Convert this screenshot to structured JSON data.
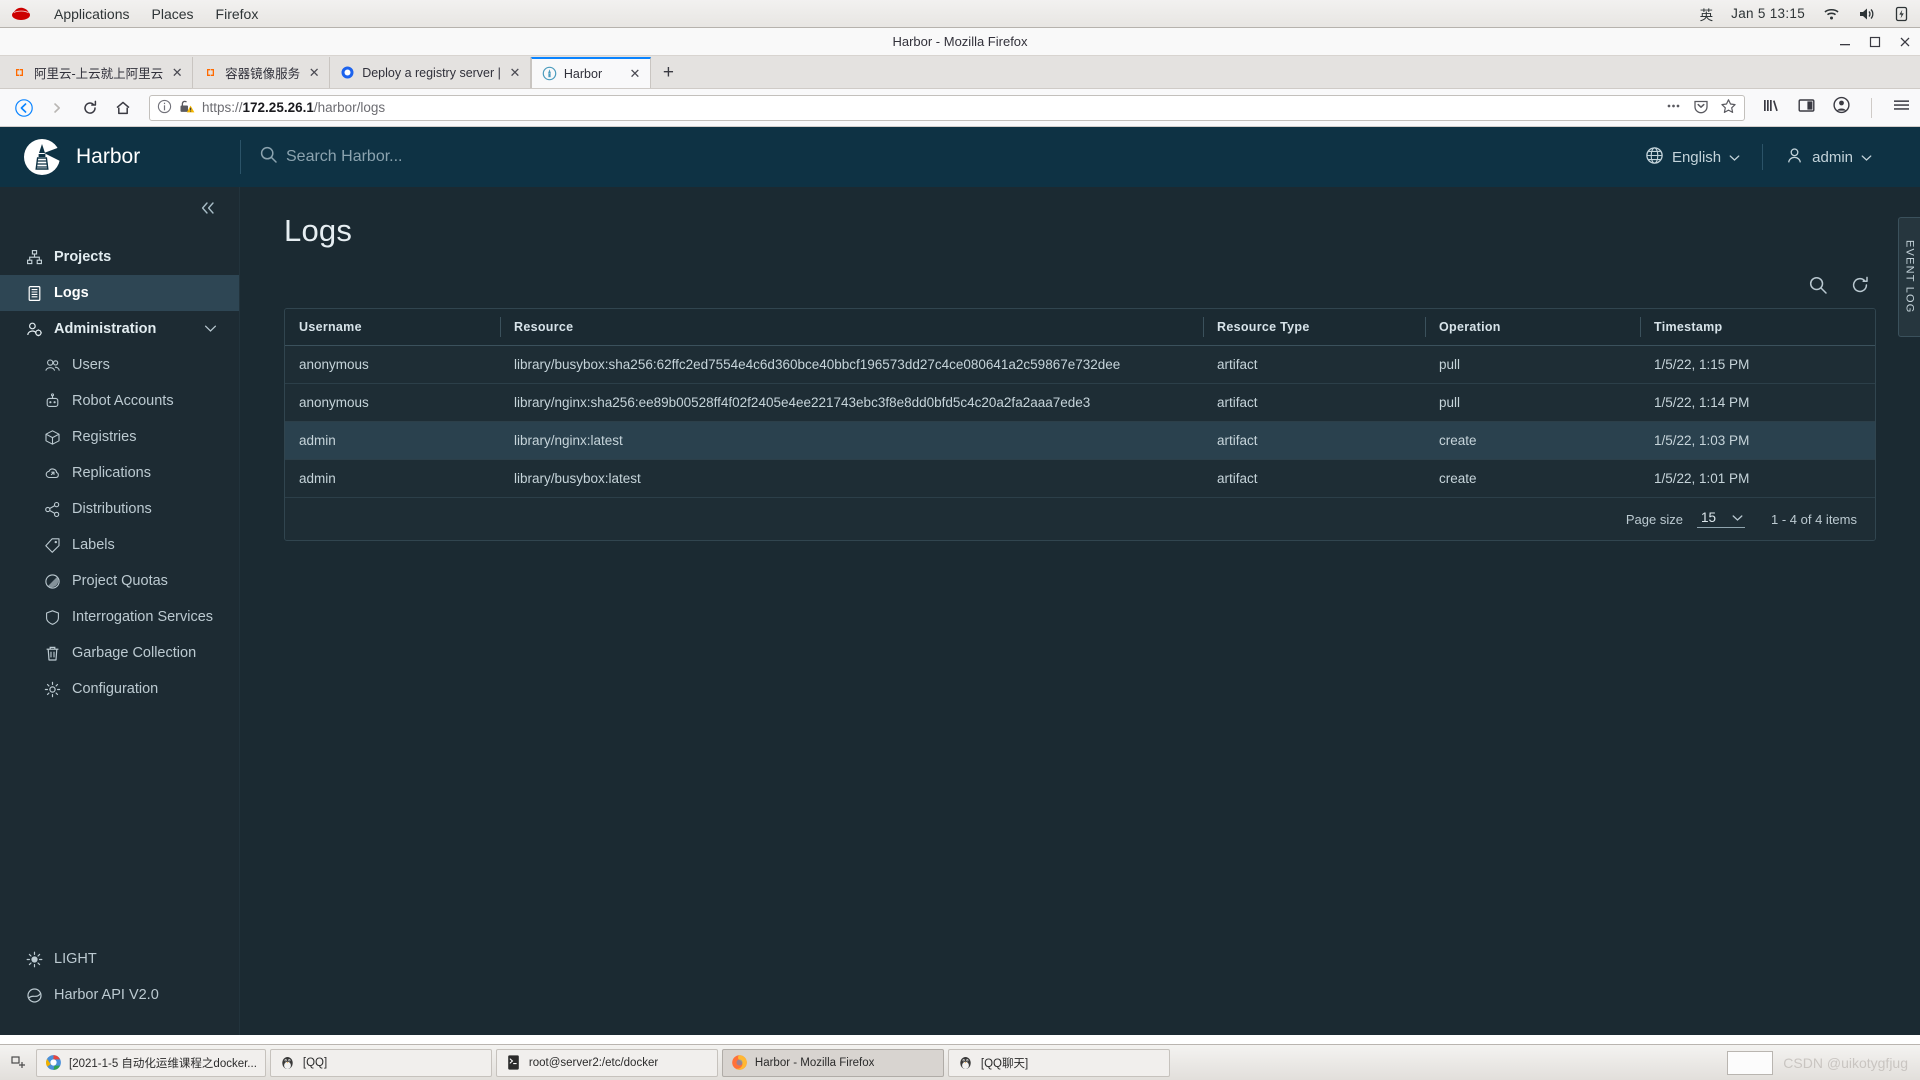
{
  "desktop": {
    "menus": [
      "Applications",
      "Places",
      "Firefox"
    ],
    "logo_icon": "redhat-logo",
    "input_method": "英",
    "clock": "Jan 5  13:15",
    "tray_icons": [
      "wifi-icon",
      "volume-icon",
      "battery-icon"
    ]
  },
  "browser": {
    "window_title": "Harbor - Mozilla Firefox",
    "window_buttons": [
      "minimize-button",
      "maximize-button",
      "close-button"
    ],
    "tabs": [
      {
        "label": "阿里云-上云就上阿里云",
        "favicon": "aliyun-favicon",
        "active": false
      },
      {
        "label": "容器镜像服务",
        "favicon": "aliyun-favicon",
        "active": false
      },
      {
        "label": "Deploy a registry server |",
        "favicon": "docker-favicon",
        "active": false
      },
      {
        "label": "Harbor",
        "favicon": "harbor-favicon",
        "active": true
      }
    ],
    "new_tab_label": "+",
    "nav": {
      "back": "back-arrow",
      "forward": "forward-arrow",
      "reload": "reload-icon",
      "home": "home-icon"
    },
    "url": {
      "prefix": "https://",
      "host": "172.25.26.1",
      "path": "/harbor/logs",
      "identity_icon": "page-info-icon",
      "security_icon": "broken-lock-warning-icon",
      "page_actions": [
        "ellipsis-icon",
        "pocket-icon",
        "bookmark-star-icon"
      ]
    },
    "toolbar_icons": [
      "library-icon",
      "sidebar-icon",
      "account-icon",
      "hamburger-menu-icon"
    ]
  },
  "harbor": {
    "brand": "Harbor",
    "logo_icon": "harbor-lighthouse-logo",
    "search_placeholder": "Search Harbor...",
    "search_icon": "search-icon",
    "language": "English",
    "language_icon": "globe-icon",
    "user": "admin",
    "user_icon": "user-icon",
    "collapse_icon": "collapse-double-chevron-left",
    "sidebar": {
      "items": [
        {
          "label": "Projects",
          "icon": "projects-icon",
          "level": "top",
          "active": false
        },
        {
          "label": "Logs",
          "icon": "logs-icon",
          "level": "top",
          "active": true
        },
        {
          "label": "Administration",
          "icon": "administration-icon",
          "level": "top",
          "active": false,
          "expanded": true,
          "chevron": "chevron-down-icon"
        },
        {
          "label": "Users",
          "icon": "users-icon",
          "level": "sub",
          "active": false
        },
        {
          "label": "Robot Accounts",
          "icon": "robot-icon",
          "level": "sub",
          "active": false
        },
        {
          "label": "Registries",
          "icon": "registries-cube-icon",
          "level": "sub",
          "active": false
        },
        {
          "label": "Replications",
          "icon": "replications-cloud-icon",
          "level": "sub",
          "active": false
        },
        {
          "label": "Distributions",
          "icon": "distributions-share-icon",
          "level": "sub",
          "active": false
        },
        {
          "label": "Labels",
          "icon": "label-tag-icon",
          "level": "sub",
          "active": false
        },
        {
          "label": "Project Quotas",
          "icon": "quota-pie-icon",
          "level": "sub",
          "active": false
        },
        {
          "label": "Interrogation Services",
          "icon": "shield-icon",
          "level": "sub",
          "active": false
        },
        {
          "label": "Garbage Collection",
          "icon": "trash-icon",
          "level": "sub",
          "active": false
        },
        {
          "label": "Configuration",
          "icon": "gear-icon",
          "level": "sub",
          "active": false
        }
      ],
      "bottom_items": [
        {
          "label": "LIGHT",
          "icon": "sun-icon"
        },
        {
          "label": "Harbor API V2.0",
          "icon": "api-icon"
        }
      ]
    },
    "page_title": "Logs",
    "table_actions": [
      {
        "name": "search-icon"
      },
      {
        "name": "refresh-icon"
      }
    ],
    "table": {
      "columns": [
        "Username",
        "Resource",
        "Resource Type",
        "Operation",
        "Timestamp"
      ],
      "rows": [
        {
          "username": "anonymous",
          "resource": "library/busybox:sha256:62ffc2ed7554e4c6d360bce40bbcf196573dd27c4ce080641a2c59867e732dee",
          "resource_type": "artifact",
          "operation": "pull",
          "timestamp": "1/5/22, 1:15 PM",
          "hover": false
        },
        {
          "username": "anonymous",
          "resource": "library/nginx:sha256:ee89b00528ff4f02f2405e4ee221743ebc3f8e8dd0bfd5c4c20a2fa2aaa7ede3",
          "resource_type": "artifact",
          "operation": "pull",
          "timestamp": "1/5/22, 1:14 PM",
          "hover": false
        },
        {
          "username": "admin",
          "resource": "library/nginx:latest",
          "resource_type": "artifact",
          "operation": "create",
          "timestamp": "1/5/22, 1:03 PM",
          "hover": true
        },
        {
          "username": "admin",
          "resource": "library/busybox:latest",
          "resource_type": "artifact",
          "operation": "create",
          "timestamp": "1/5/22, 1:01 PM",
          "hover": false
        }
      ],
      "footer": {
        "page_size_label": "Page size",
        "page_size_value": "15",
        "page_size_chevron": "chevron-down-icon",
        "items_range": "1 - 4 of 4 items"
      }
    },
    "event_log_tab": "EVENT LOG"
  },
  "taskbar": {
    "show_desktop_icon": "show-desktop-icon",
    "items": [
      {
        "label": "[2021-1-5 自动化运维课程之docker...",
        "icon": "chrome-icon",
        "active": false
      },
      {
        "label": "[QQ]",
        "icon": "qq-penguin-icon",
        "active": false
      },
      {
        "label": "root@server2:/etc/docker",
        "icon": "terminal-icon",
        "active": false
      },
      {
        "label": "Harbor - Mozilla Firefox",
        "icon": "firefox-icon",
        "active": true
      },
      {
        "label": "[QQ聊天]",
        "icon": "qq-penguin-icon",
        "active": false
      }
    ],
    "watermark": "CSDN @uikotygfjug"
  },
  "colors": {
    "harbor_header": "#0e3244",
    "harbor_sidebar": "#1d2b33",
    "harbor_body": "#1b2a32",
    "accent_active": "#2e4654",
    "firefox_active_tab": "#0a84ff"
  }
}
